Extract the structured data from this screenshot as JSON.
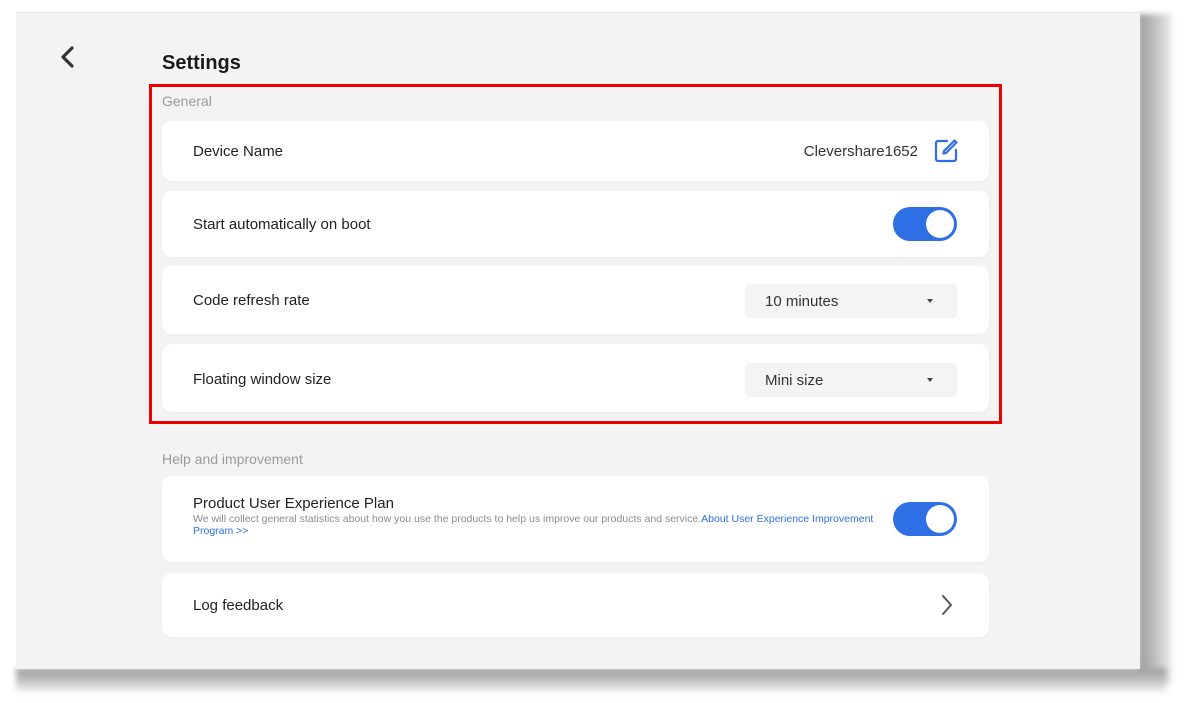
{
  "header": {
    "title": "Settings",
    "back_icon": "chevron-left-icon"
  },
  "general": {
    "section_label": "General",
    "device_name": {
      "label": "Device Name",
      "value": "Clevershare1652",
      "icon": "edit-icon"
    },
    "auto_start": {
      "label": "Start automatically on boot",
      "enabled": true
    },
    "code_refresh": {
      "label": "Code refresh rate",
      "selected": "10 minutes"
    },
    "floating_window": {
      "label": "Floating window size",
      "selected": "Mini size"
    }
  },
  "help": {
    "section_label": "Help and improvement",
    "ux_plan": {
      "label": "Product User Experience Plan",
      "description": "We will collect general statistics about how you use the products to help us improve our products and service.",
      "link_text": "About User Experience Improvement Program >>",
      "enabled": true
    },
    "log_feedback": {
      "label": "Log feedback",
      "icon": "chevron-right-icon"
    }
  },
  "colors": {
    "accent": "#2e6fe6",
    "highlight": "#ee0000",
    "background": "#f3f3f4"
  }
}
